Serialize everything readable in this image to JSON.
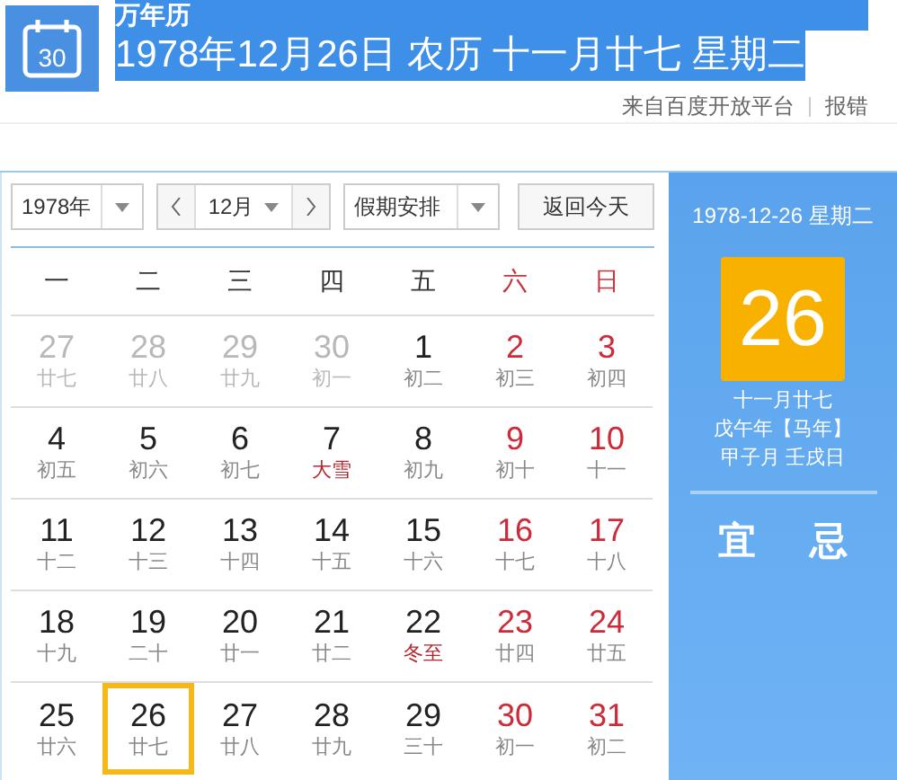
{
  "header": {
    "title": "万年历",
    "title_highlighted": true,
    "date_line": "1978年12月26日 农历 十一月廿七 星期二",
    "date_highlighted": true,
    "icon_day": "30",
    "source": "来自百度开放平台",
    "report": "报错"
  },
  "controls": {
    "year": "1978年",
    "month": "12月",
    "holiday": "假期安排",
    "today_button": "返回今天"
  },
  "weekdays": [
    {
      "label": "一",
      "weekend": false
    },
    {
      "label": "二",
      "weekend": false
    },
    {
      "label": "三",
      "weekend": false
    },
    {
      "label": "四",
      "weekend": false
    },
    {
      "label": "五",
      "weekend": false
    },
    {
      "label": "六",
      "weekend": true
    },
    {
      "label": "日",
      "weekend": true
    }
  ],
  "days": [
    {
      "day": "27",
      "lunar": "廿七",
      "kind": "other",
      "term": false,
      "selected": false
    },
    {
      "day": "28",
      "lunar": "廿八",
      "kind": "other",
      "term": false,
      "selected": false
    },
    {
      "day": "29",
      "lunar": "廿九",
      "kind": "other",
      "term": false,
      "selected": false
    },
    {
      "day": "30",
      "lunar": "初一",
      "kind": "other",
      "term": false,
      "selected": false
    },
    {
      "day": "1",
      "lunar": "初二",
      "kind": "normal",
      "term": false,
      "selected": false
    },
    {
      "day": "2",
      "lunar": "初三",
      "kind": "weekend",
      "term": false,
      "selected": false
    },
    {
      "day": "3",
      "lunar": "初四",
      "kind": "weekend",
      "term": false,
      "selected": false
    },
    {
      "day": "4",
      "lunar": "初五",
      "kind": "normal",
      "term": false,
      "selected": false
    },
    {
      "day": "5",
      "lunar": "初六",
      "kind": "normal",
      "term": false,
      "selected": false
    },
    {
      "day": "6",
      "lunar": "初七",
      "kind": "normal",
      "term": false,
      "selected": false
    },
    {
      "day": "7",
      "lunar": "大雪",
      "kind": "normal",
      "term": true,
      "selected": false
    },
    {
      "day": "8",
      "lunar": "初九",
      "kind": "normal",
      "term": false,
      "selected": false
    },
    {
      "day": "9",
      "lunar": "初十",
      "kind": "weekend",
      "term": false,
      "selected": false
    },
    {
      "day": "10",
      "lunar": "十一",
      "kind": "weekend",
      "term": false,
      "selected": false
    },
    {
      "day": "11",
      "lunar": "十二",
      "kind": "normal",
      "term": false,
      "selected": false
    },
    {
      "day": "12",
      "lunar": "十三",
      "kind": "normal",
      "term": false,
      "selected": false
    },
    {
      "day": "13",
      "lunar": "十四",
      "kind": "normal",
      "term": false,
      "selected": false
    },
    {
      "day": "14",
      "lunar": "十五",
      "kind": "normal",
      "term": false,
      "selected": false
    },
    {
      "day": "15",
      "lunar": "十六",
      "kind": "normal",
      "term": false,
      "selected": false
    },
    {
      "day": "16",
      "lunar": "十七",
      "kind": "weekend",
      "term": false,
      "selected": false
    },
    {
      "day": "17",
      "lunar": "十八",
      "kind": "weekend",
      "term": false,
      "selected": false
    },
    {
      "day": "18",
      "lunar": "十九",
      "kind": "normal",
      "term": false,
      "selected": false
    },
    {
      "day": "19",
      "lunar": "二十",
      "kind": "normal",
      "term": false,
      "selected": false
    },
    {
      "day": "20",
      "lunar": "廿一",
      "kind": "normal",
      "term": false,
      "selected": false
    },
    {
      "day": "21",
      "lunar": "廿二",
      "kind": "normal",
      "term": false,
      "selected": false
    },
    {
      "day": "22",
      "lunar": "冬至",
      "kind": "normal",
      "term": true,
      "selected": false
    },
    {
      "day": "23",
      "lunar": "廿四",
      "kind": "weekend",
      "term": false,
      "selected": false
    },
    {
      "day": "24",
      "lunar": "廿五",
      "kind": "weekend",
      "term": false,
      "selected": false
    },
    {
      "day": "25",
      "lunar": "廿六",
      "kind": "normal",
      "term": false,
      "selected": false
    },
    {
      "day": "26",
      "lunar": "廿七",
      "kind": "normal",
      "term": false,
      "selected": true
    },
    {
      "day": "27",
      "lunar": "廿八",
      "kind": "normal",
      "term": false,
      "selected": false
    },
    {
      "day": "28",
      "lunar": "廿九",
      "kind": "normal",
      "term": false,
      "selected": false
    },
    {
      "day": "29",
      "lunar": "三十",
      "kind": "normal",
      "term": false,
      "selected": false
    },
    {
      "day": "30",
      "lunar": "初一",
      "kind": "weekend",
      "term": false,
      "selected": false
    },
    {
      "day": "31",
      "lunar": "初二",
      "kind": "weekend",
      "term": false,
      "selected": false
    }
  ],
  "side": {
    "date": "1978-12-26 星期二",
    "big_day": "26",
    "lunar_lines": [
      "十一月廿七",
      "戊午年【马年】",
      "甲子月 壬戌日"
    ],
    "good": "宜",
    "bad": "忌"
  }
}
